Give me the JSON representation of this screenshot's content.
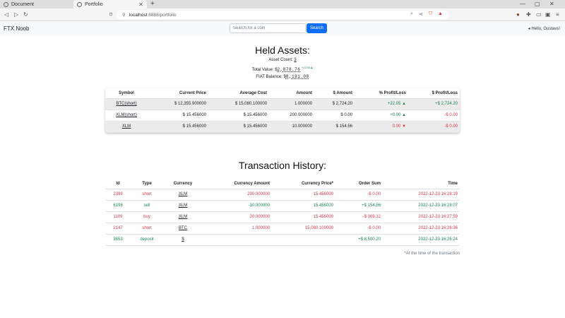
{
  "browser": {
    "tabs": [
      {
        "title": "Document"
      },
      {
        "title": "Portfolio"
      }
    ],
    "url_host": "localhost",
    "url_path": ":8888/portfolio"
  },
  "navbar": {
    "brand": "FTX Noob",
    "search_placeholder": "Search for a coin",
    "search_button": "Search",
    "user_greeting": "Hello, Gustavs!"
  },
  "held_assets": {
    "title": "Held Assets:",
    "asset_count_label": "Asset Count:",
    "asset_count": "3",
    "total_value_label": "Total Value: $",
    "total_value": "2,878.76",
    "total_value_change": "+22.05",
    "total_value_arrow": "▲",
    "fiat_label": "FIAT Balance: $",
    "fiat_balance": "8,191.08",
    "columns": [
      "Symbol",
      "Current Price",
      "Average Cost",
      "Amount",
      "$ Amount",
      "% Profit/Loss",
      "$ Profit/Loss"
    ],
    "rows": [
      {
        "symbol": "BTC(short)",
        "current_price": "$ 12,355.900000",
        "average_cost": "$ 15,080.100000",
        "amount": "1.000000",
        "usd_amount": "$ 2,724.20",
        "pct_pl": "+22.05",
        "pct_arrow": "▲",
        "usd_pl": "+$ 2,724.20",
        "trend": "up"
      },
      {
        "symbol": "XLM(short)",
        "current_price": "$ 15.456000",
        "average_cost": "$ 15.456000",
        "amount": "200.000000",
        "usd_amount": "$ 0.00",
        "pct_pl": "+0.00",
        "pct_arrow": "▲",
        "usd_pl": "-$ 0.00",
        "trend": "up"
      },
      {
        "symbol": "XLM",
        "current_price": "$ 15.456000",
        "average_cost": "$ 15.456000",
        "amount": "10.000000",
        "usd_amount": "$ 154.56",
        "pct_pl": "0.00",
        "pct_arrow": "▼",
        "usd_pl": "-$ 0.00",
        "trend": "down"
      }
    ]
  },
  "transactions": {
    "title": "Transaction History:",
    "columns": [
      "Id",
      "Type",
      "Currency",
      "Currency Amount",
      "Currency Price*",
      "Order Sum",
      "Time"
    ],
    "rows": [
      {
        "id": "2399",
        "type": "short",
        "currency": "XLM",
        "currency_amount": "200.000000",
        "currency_price": "15.456000",
        "order_sum": "-$ 0.00",
        "time": "2022-12-23 16:28:19",
        "tone": "red"
      },
      {
        "id": "6198",
        "type": "sell",
        "currency": "XLM",
        "currency_amount": "-10.000000",
        "currency_price": "15.456000",
        "order_sum": "+$ 154.56",
        "time": "2022-12-23 16:28:07",
        "tone": "green"
      },
      {
        "id": "1109",
        "type": "buy",
        "currency": "XLM",
        "currency_amount": "20.000000",
        "currency_price": "15.456000",
        "order_sum": "-$ 309.12",
        "time": "2022-12-23 16:27:59",
        "tone": "red"
      },
      {
        "id": "2147",
        "type": "short",
        "currency": "BTC",
        "currency_amount": "1.000000",
        "currency_price": "15,080.100000",
        "order_sum": "-$ 0.00",
        "time": "2022-12-23 16:26:36",
        "tone": "red"
      },
      {
        "id": "3653",
        "type": "deposit",
        "currency": "$",
        "currency_amount": "",
        "currency_price": "",
        "order_sum": "+$ 8,500.20",
        "time": "2022-12-23 16:26:24",
        "tone": "green"
      }
    ],
    "footnote": "*At the time of the transaction"
  }
}
